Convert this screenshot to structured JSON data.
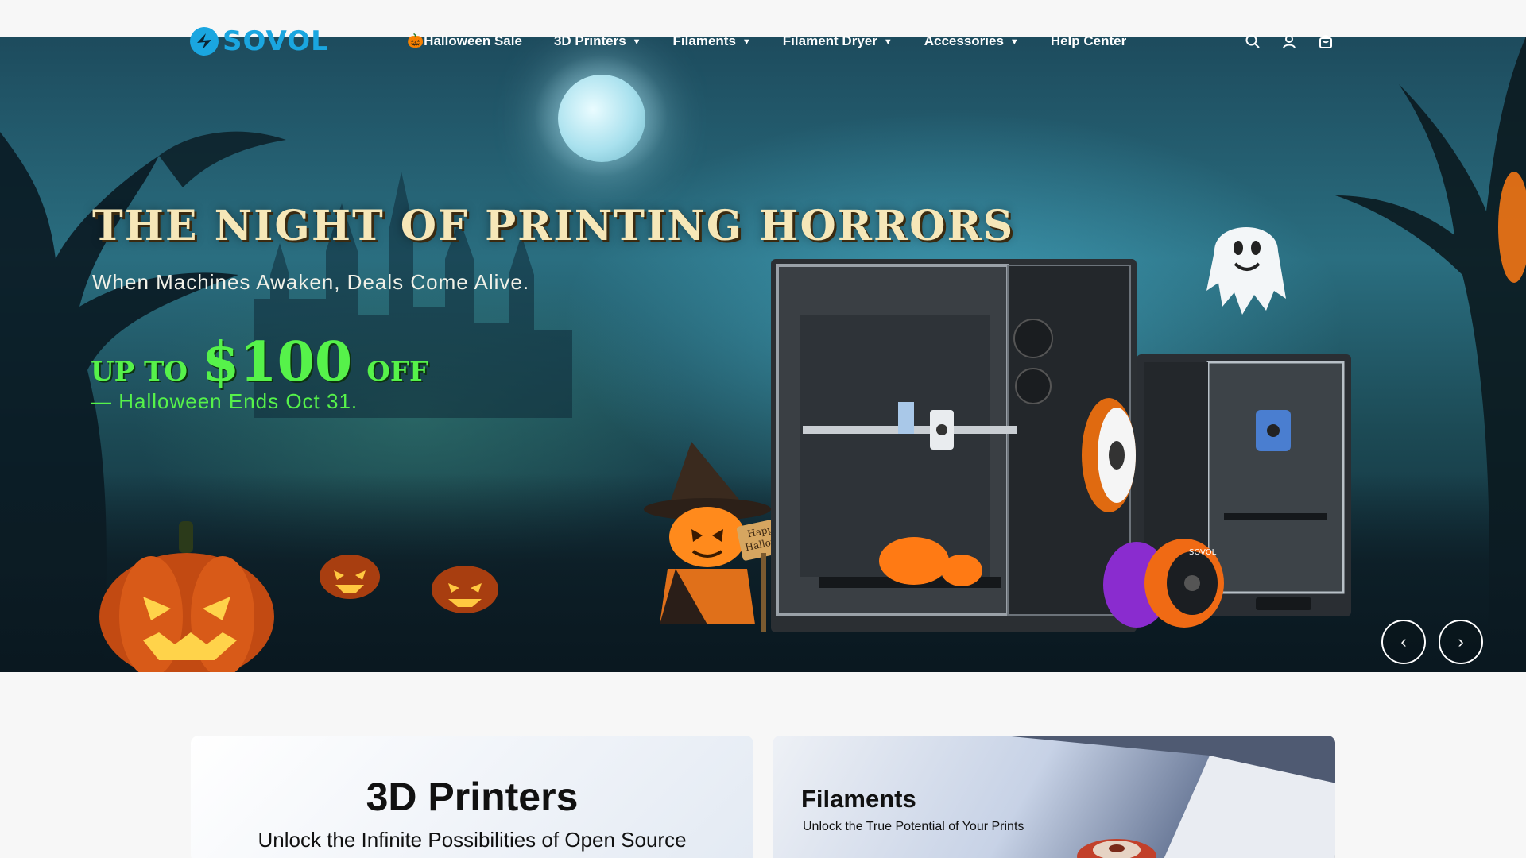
{
  "brand": {
    "name": "SOVOL",
    "color": "#1aa6e0"
  },
  "nav": {
    "items": [
      {
        "label": "🎃Halloween Sale",
        "has_dropdown": false
      },
      {
        "label": "3D Printers",
        "has_dropdown": true
      },
      {
        "label": "Filaments",
        "has_dropdown": true
      },
      {
        "label": "Filament Dryer",
        "has_dropdown": true
      },
      {
        "label": "Accessories",
        "has_dropdown": true
      },
      {
        "label": "Help Center",
        "has_dropdown": false
      }
    ],
    "icons": [
      "search-icon",
      "account-icon",
      "cart-icon"
    ]
  },
  "hero": {
    "title": "THE NIGHT OF PRINTING HORRORS",
    "subtitle": "When Machines Awaken, Deals Come Alive.",
    "upto_prefix": "UP TO",
    "amount": "$100",
    "upto_suffix": "OFF",
    "ends": "— Halloween Ends Oct 31.",
    "sign_text_1": "Happy",
    "sign_text_2": "Halloween",
    "spool_brand": "SOVOL",
    "prev_label": "‹",
    "next_label": "›",
    "accent_green": "#56f24a"
  },
  "cards": {
    "printers": {
      "title": "3D Printers",
      "subtitle": "Unlock the Infinite Possibilities of Open Source"
    },
    "filaments": {
      "title": "Filaments",
      "subtitle": "Unlock the True Potential of Your Prints"
    }
  }
}
